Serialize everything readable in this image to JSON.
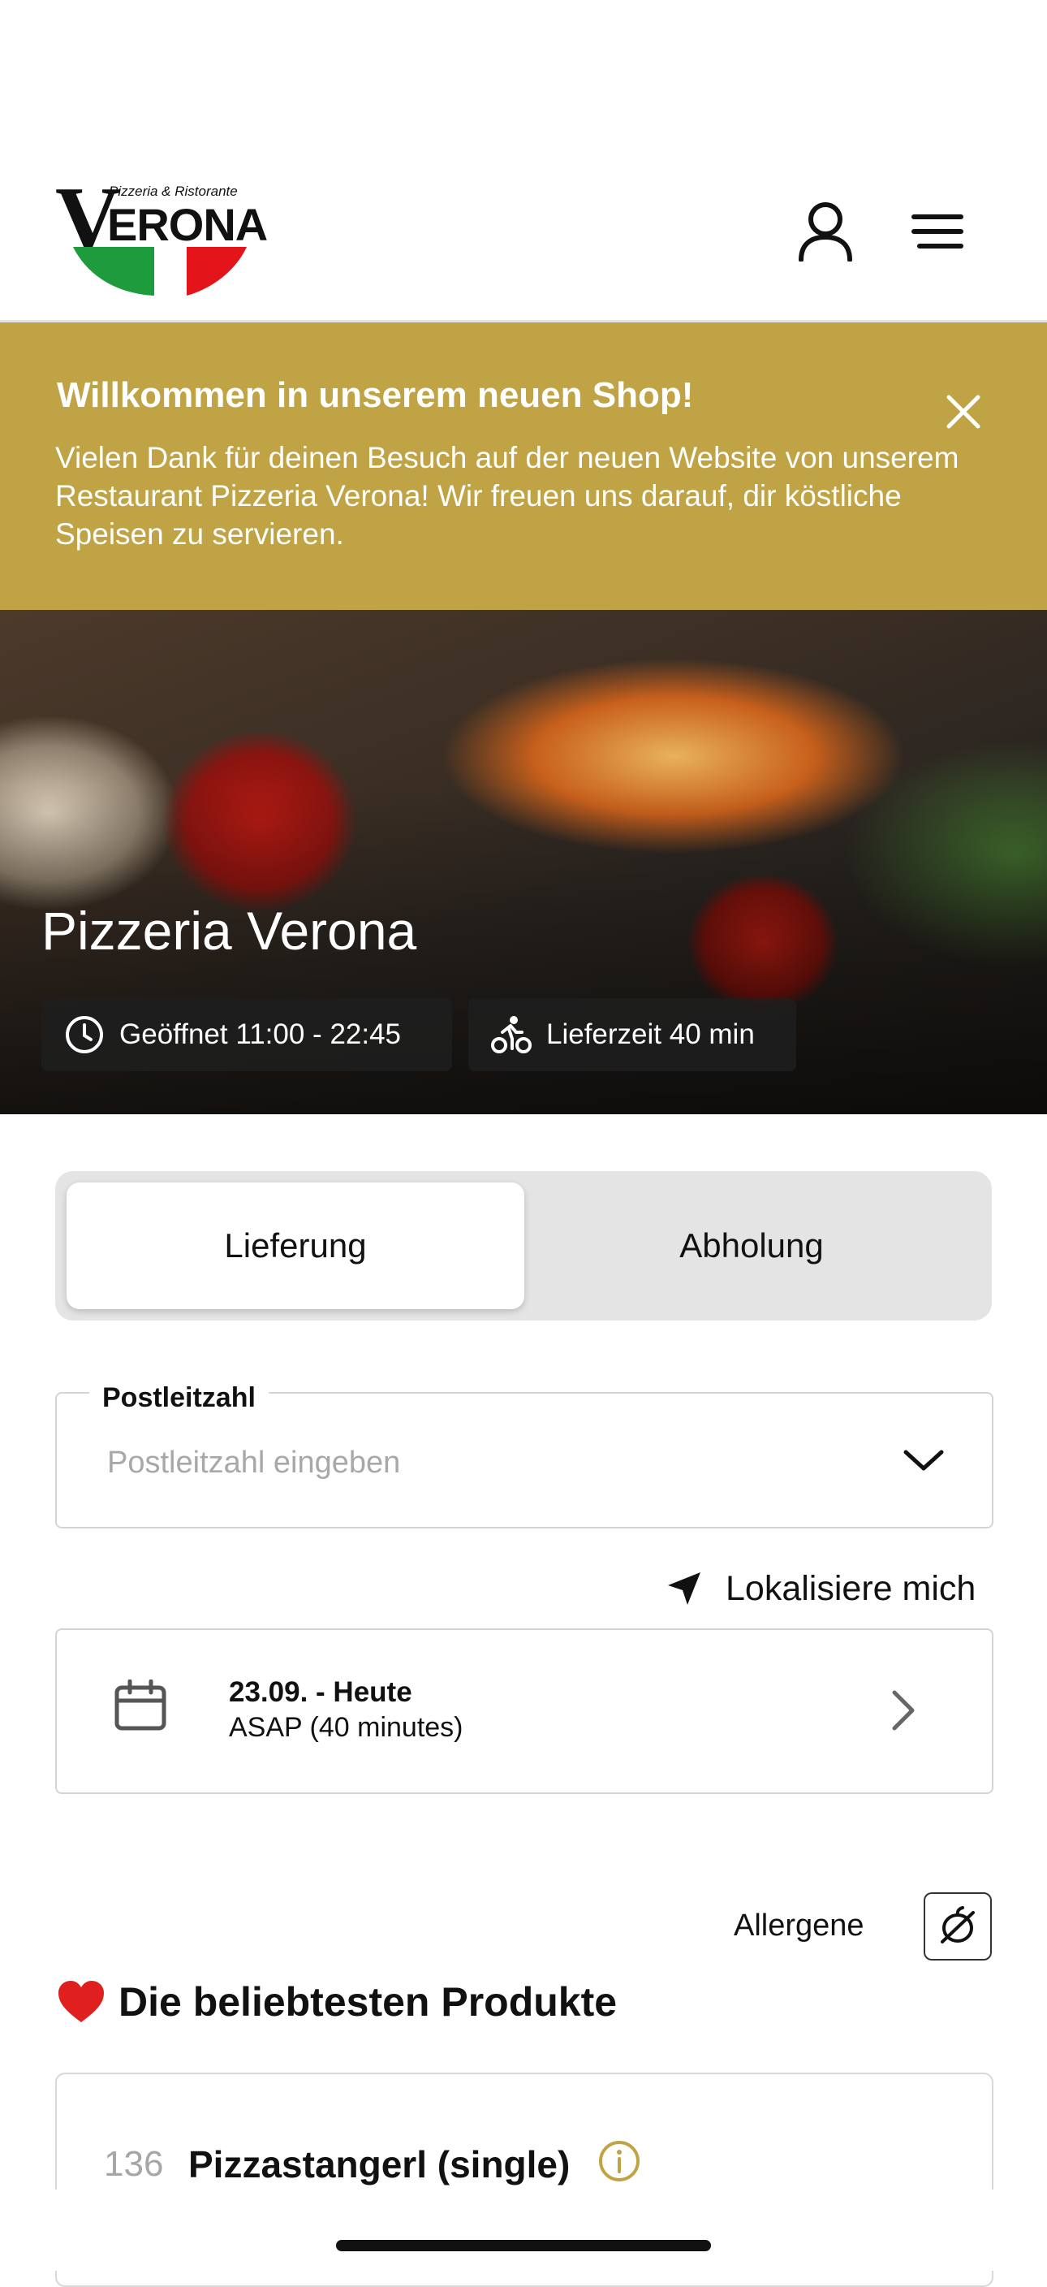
{
  "header": {
    "logo_initial": "V",
    "logo_text": "ERONA",
    "logo_subtitle": "Pizzeria & Ristorante",
    "account_icon": "user-icon",
    "menu_icon": "hamburger-menu-icon"
  },
  "banner": {
    "title": "Willkommen in unserem neuen Shop!",
    "text": "Vielen Dank für deinen Besuch auf der neuen Website von unserem Restaurant Pizzeria Verona! Wir freuen uns darauf, dir köstliche Speisen zu servieren.",
    "close_icon": "close-icon",
    "background_color": "#bfa345"
  },
  "hero": {
    "title": "Pizzeria Verona",
    "opening_hours": "Geöffnet 11:00 - 22:45",
    "delivery_time": "Lieferzeit 40 min"
  },
  "order_mode": {
    "options": [
      "Lieferung",
      "Abholung"
    ],
    "selected": "Lieferung"
  },
  "zip": {
    "label": "Postleitzahl",
    "placeholder": "Postleitzahl eingeben",
    "value": ""
  },
  "locate": {
    "label": "Lokalisiere mich",
    "icon": "location-arrow-icon"
  },
  "schedule": {
    "date": "23.09. - Heute",
    "time": "ASAP (40 minutes)",
    "icon": "calendar-icon"
  },
  "allergens": {
    "label": "Allergene",
    "icon": "allergen-filter-icon"
  },
  "popular": {
    "title": "Die beliebtesten Produkte",
    "icon": "heart-icon",
    "products": [
      {
        "number": "136",
        "name": "Pizzastangerl (single)"
      }
    ]
  }
}
